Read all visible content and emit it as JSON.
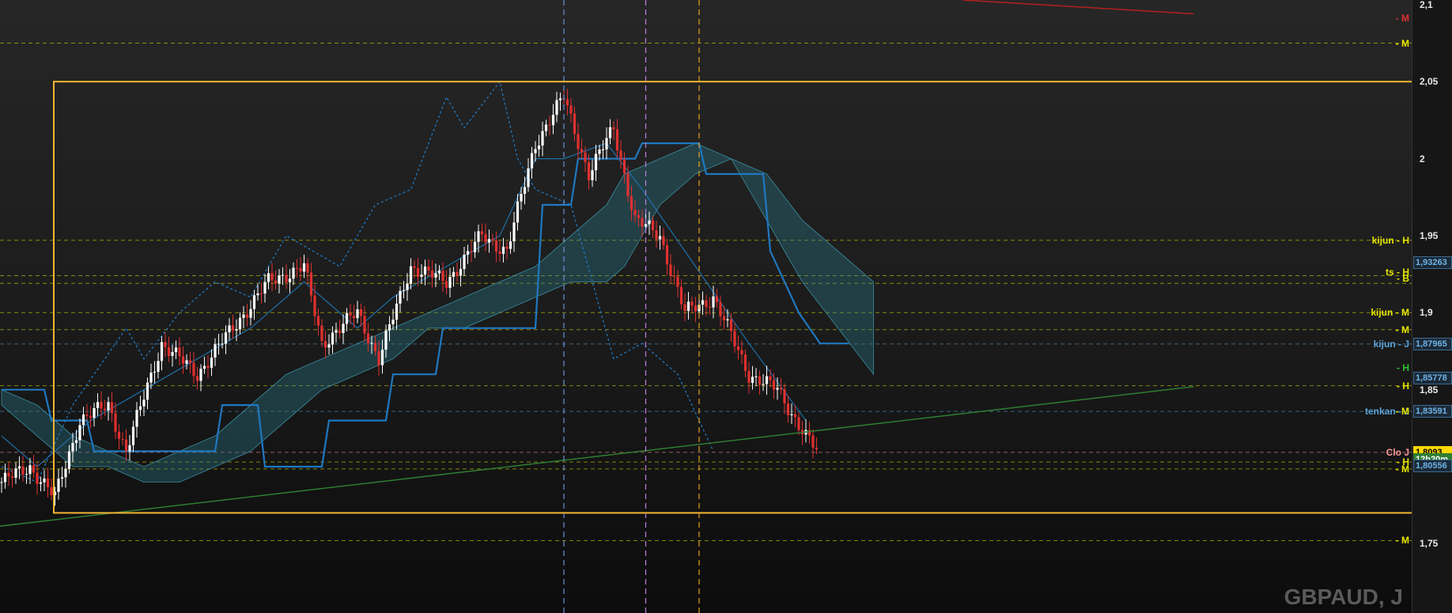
{
  "instrument": "GBPAUD, J",
  "chart_data": {
    "type": "candlestick",
    "symbol": "GBPAUD",
    "timeframe": "J",
    "ylim": [
      1.705,
      2.103
    ],
    "y_ticks": [
      "2,1",
      "2,05",
      "2",
      "1,95",
      "1,9",
      "1,85",
      "1,8",
      "1,75"
    ],
    "y_tick_values": [
      2.1,
      2.05,
      2.0,
      1.95,
      1.9,
      1.85,
      1.8,
      1.75
    ],
    "anchors": [
      [
        0,
        1.79
      ],
      [
        8,
        1.8
      ],
      [
        15,
        1.78
      ],
      [
        22,
        1.83
      ],
      [
        30,
        1.84
      ],
      [
        35,
        1.81
      ],
      [
        45,
        1.88
      ],
      [
        55,
        1.86
      ],
      [
        65,
        1.89
      ],
      [
        75,
        1.92
      ],
      [
        85,
        1.93
      ],
      [
        90,
        1.88
      ],
      [
        100,
        1.9
      ],
      [
        106,
        1.87
      ],
      [
        115,
        1.93
      ],
      [
        125,
        1.92
      ],
      [
        135,
        1.95
      ],
      [
        142,
        1.94
      ],
      [
        150,
        2.01
      ],
      [
        158,
        2.04
      ],
      [
        165,
        1.99
      ],
      [
        172,
        2.02
      ],
      [
        178,
        1.96
      ],
      [
        185,
        1.95
      ],
      [
        192,
        1.9
      ],
      [
        200,
        1.91
      ],
      [
        210,
        1.86
      ],
      [
        218,
        1.85
      ],
      [
        226,
        1.82
      ],
      [
        229,
        1.81
      ]
    ],
    "tenkan": [
      [
        0,
        1.82
      ],
      [
        10,
        1.8
      ],
      [
        25,
        1.83
      ],
      [
        40,
        1.85
      ],
      [
        55,
        1.87
      ],
      [
        70,
        1.89
      ],
      [
        85,
        1.92
      ],
      [
        100,
        1.89
      ],
      [
        110,
        1.91
      ],
      [
        125,
        1.93
      ],
      [
        140,
        1.95
      ],
      [
        150,
        2.0
      ],
      [
        158,
        2.0
      ],
      [
        170,
        2.01
      ],
      [
        180,
        1.98
      ],
      [
        195,
        1.93
      ],
      [
        210,
        1.88
      ],
      [
        226,
        1.83
      ]
    ],
    "kijun": [
      [
        0,
        1.85
      ],
      [
        12,
        1.85
      ],
      [
        14,
        1.83
      ],
      [
        24,
        1.83
      ],
      [
        26,
        1.81
      ],
      [
        60,
        1.81
      ],
      [
        62,
        1.84
      ],
      [
        72,
        1.84
      ],
      [
        74,
        1.8
      ],
      [
        90,
        1.8
      ],
      [
        92,
        1.83
      ],
      [
        108,
        1.83
      ],
      [
        110,
        1.86
      ],
      [
        122,
        1.86
      ],
      [
        124,
        1.89
      ],
      [
        150,
        1.89
      ],
      [
        152,
        1.97
      ],
      [
        160,
        1.97
      ],
      [
        162,
        2.0
      ],
      [
        178,
        2.0
      ],
      [
        180,
        2.01
      ],
      [
        196,
        2.01
      ],
      [
        198,
        1.99
      ],
      [
        214,
        1.99
      ],
      [
        216,
        1.94
      ],
      [
        224,
        1.9
      ],
      [
        230,
        1.88
      ],
      [
        238,
        1.88
      ]
    ],
    "chikou": [
      [
        0,
        1.8
      ],
      [
        10,
        1.79
      ],
      [
        20,
        1.84
      ],
      [
        35,
        1.89
      ],
      [
        40,
        1.87
      ],
      [
        50,
        1.9
      ],
      [
        60,
        1.92
      ],
      [
        70,
        1.91
      ],
      [
        80,
        1.95
      ],
      [
        95,
        1.93
      ],
      [
        105,
        1.97
      ],
      [
        115,
        1.98
      ],
      [
        125,
        2.04
      ],
      [
        130,
        2.02
      ],
      [
        140,
        2.05
      ],
      [
        145,
        2.0
      ],
      [
        150,
        1.98
      ],
      [
        160,
        1.97
      ],
      [
        172,
        1.87
      ],
      [
        180,
        1.88
      ],
      [
        190,
        1.86
      ],
      [
        200,
        1.81
      ]
    ],
    "cloud": [
      [
        0,
        1.85,
        1.84
      ],
      [
        10,
        1.84,
        1.82
      ],
      [
        20,
        1.82,
        1.8
      ],
      [
        30,
        1.81,
        1.8
      ],
      [
        40,
        1.8,
        1.79
      ],
      [
        50,
        1.81,
        1.79
      ],
      [
        60,
        1.82,
        1.8
      ],
      [
        70,
        1.84,
        1.81
      ],
      [
        80,
        1.86,
        1.83
      ],
      [
        90,
        1.87,
        1.85
      ],
      [
        100,
        1.88,
        1.86
      ],
      [
        110,
        1.89,
        1.87
      ],
      [
        120,
        1.9,
        1.89
      ],
      [
        130,
        1.91,
        1.89
      ],
      [
        140,
        1.92,
        1.9
      ],
      [
        150,
        1.93,
        1.91
      ],
      [
        160,
        1.95,
        1.92
      ],
      [
        170,
        1.97,
        1.92
      ],
      [
        175,
        1.99,
        1.93
      ],
      [
        185,
        2.0,
        1.97
      ],
      [
        195,
        2.01,
        1.99
      ],
      [
        205,
        2.0,
        2.0
      ],
      [
        215,
        1.99,
        1.96
      ],
      [
        225,
        1.96,
        1.92
      ],
      [
        235,
        1.94,
        1.89
      ],
      [
        245,
        1.92,
        1.86
      ]
    ],
    "horizontal_levels": [
      {
        "value": 2.075,
        "label": "- M",
        "color": "#e6e600",
        "style": "dashed"
      },
      {
        "value": 1.947,
        "label": "kijun - H",
        "color": "#e6e600",
        "style": "dashed"
      },
      {
        "value": 1.924,
        "label": "",
        "color": "#e6e600",
        "style": "dashed"
      },
      {
        "value": 1.919,
        "label": "",
        "color": "#e6e600",
        "style": "dashed"
      },
      {
        "value": 1.9,
        "label": "kijun - M",
        "color": "#e6e600",
        "style": "dashed"
      },
      {
        "value": 1.889,
        "label": "- M",
        "color": "#e6e600",
        "style": "dashed"
      },
      {
        "value": 1.8797,
        "label": "kijun - J",
        "color": "#5ba3d9",
        "style": "dashed"
      },
      {
        "value": 1.8526,
        "label": "- H",
        "color": "#e6e600",
        "style": "dashed"
      },
      {
        "value": 1.8359,
        "label": "tenkan - J",
        "color": "#5ba3d9",
        "style": "dashed"
      },
      {
        "value": 1.8093,
        "label": "Clo J",
        "color": "#ff9999",
        "style": "dashed"
      },
      {
        "value": 1.803,
        "label": "- H",
        "color": "#e6e600",
        "style": "dashed"
      },
      {
        "value": 1.7985,
        "label": "- M",
        "color": "#e6e600",
        "style": "dashed"
      },
      {
        "value": 1.752,
        "label": "- M",
        "color": "#e6e600",
        "style": "dashed"
      }
    ],
    "extra_labels": [
      {
        "value": 1.9265,
        "text": "ts - H",
        "color": "#e6e600"
      },
      {
        "value": 1.9221,
        "text": "- B",
        "color": "#e6e600"
      },
      {
        "value": 2.091,
        "text": "- M",
        "color": "#e03030"
      },
      {
        "value": 1.8643,
        "text": "- H",
        "color": "#2ec22e"
      },
      {
        "value": 1.8359,
        "text": "- M",
        "color": "#e6e600"
      }
    ],
    "price_boxes": [
      {
        "value": 1.9326,
        "text": "1,93263",
        "bg": "#1b2a38",
        "fg": "#6fb3e6",
        "border": "#3c6a92"
      },
      {
        "value": 1.8796,
        "text": "1,87965",
        "bg": "#1b2a38",
        "fg": "#6fb3e6",
        "border": "#3c6a92"
      },
      {
        "value": 1.8577,
        "text": "1,85778",
        "bg": "#1b2a38",
        "fg": "#6fb3e6",
        "border": "#3c6a92"
      },
      {
        "value": 1.8359,
        "text": "1,83591",
        "bg": "#1b2a38",
        "fg": "#6fb3e6",
        "border": "#3c6a92"
      },
      {
        "value": 1.8093,
        "text": "1,8093",
        "bg": "#ffd700",
        "fg": "#000000",
        "border": "#ffd700"
      },
      {
        "value": 1.8045,
        "text": "12h20m",
        "bg": "#2e7d32",
        "fg": "#ffffff",
        "border": "#2e7d32"
      },
      {
        "value": 1.8006,
        "text": "1,80556",
        "bg": "#1b2a38",
        "fg": "#6fb3e6",
        "border": "#3c6a92"
      }
    ],
    "vertical_lines": [
      {
        "x_index": 158,
        "color": "#6f8fd8"
      },
      {
        "x_index": 181,
        "color": "#c07ce0"
      },
      {
        "x_index": 196,
        "color": "#e6a020"
      }
    ],
    "box": {
      "y_top": 2.05,
      "y_bottom": 1.77,
      "color": "#f2b632"
    },
    "trendlines": [
      {
        "from": [
          -13,
          1.758
        ],
        "to": [
          335,
          1.852
        ],
        "color": "#2e7d32"
      },
      {
        "from": [
          270,
          2.103
        ],
        "to": [
          335,
          2.094
        ],
        "color": "#b32020"
      }
    ]
  }
}
